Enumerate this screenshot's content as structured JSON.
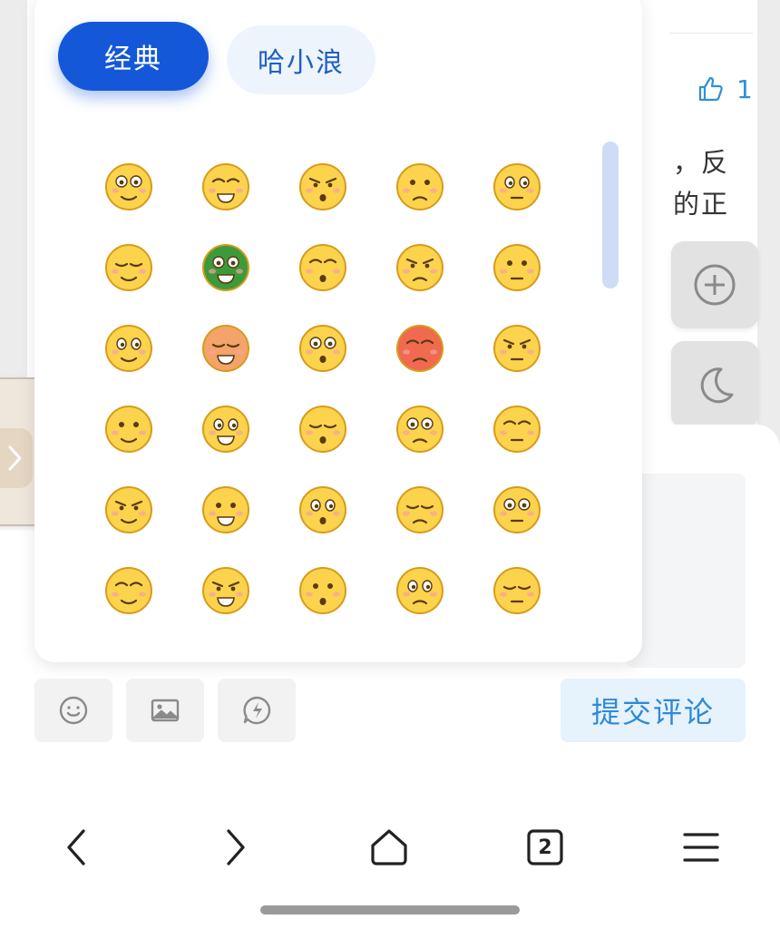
{
  "background_article": {
    "like_count": "1",
    "text_line_1": "，反",
    "text_line_2": "的正"
  },
  "side_actions": {
    "plus": "plus-circle-icon",
    "moon": "moon-icon"
  },
  "emoji_panel": {
    "tabs": [
      {
        "label": "经典",
        "active": true
      },
      {
        "label": "哈小浪",
        "active": false
      }
    ],
    "emojis": [
      "doubt-emoji",
      "roll-eyes-emoji",
      "angry-fists-emoji",
      "gagged-emoji",
      "cool-glasses-emoji",
      "grin-emoji",
      "turtle-emoji",
      "crying-emoji",
      "sunglasses-emoji",
      "blush-emoji",
      "shocked-sweat-emoji",
      "furious-fire-emoji",
      "headband-emoji",
      "red-face-emoji",
      "thinking-hand-emoji",
      "big-eyes-emoji",
      "laugh-emoji",
      "side-glance-emoji",
      "frown-emoji",
      "surprised-emoji",
      "facepalm-emoji",
      "smile-emoji",
      "touch-chin-emoji",
      "dizzy-emoji",
      "smirk-emoji",
      "question-emoji",
      "sneer-emoji",
      "hush-emoji",
      "grin-squint-emoji",
      "tears-of-joy-emoji"
    ]
  },
  "comment_toolbar": {
    "emoji_button": "smile-icon",
    "image_button": "image-icon",
    "topic_button": "lightning-icon",
    "submit_label": "提交评论"
  },
  "bottom_nav": {
    "back": "back-icon",
    "forward": "forward-icon",
    "home": "home-icon",
    "tabs_count": "2",
    "menu": "menu-icon"
  },
  "colors": {
    "accent": "#1458d9",
    "link": "#2e8ad6",
    "emoji_yellow": "#fcd34d"
  }
}
